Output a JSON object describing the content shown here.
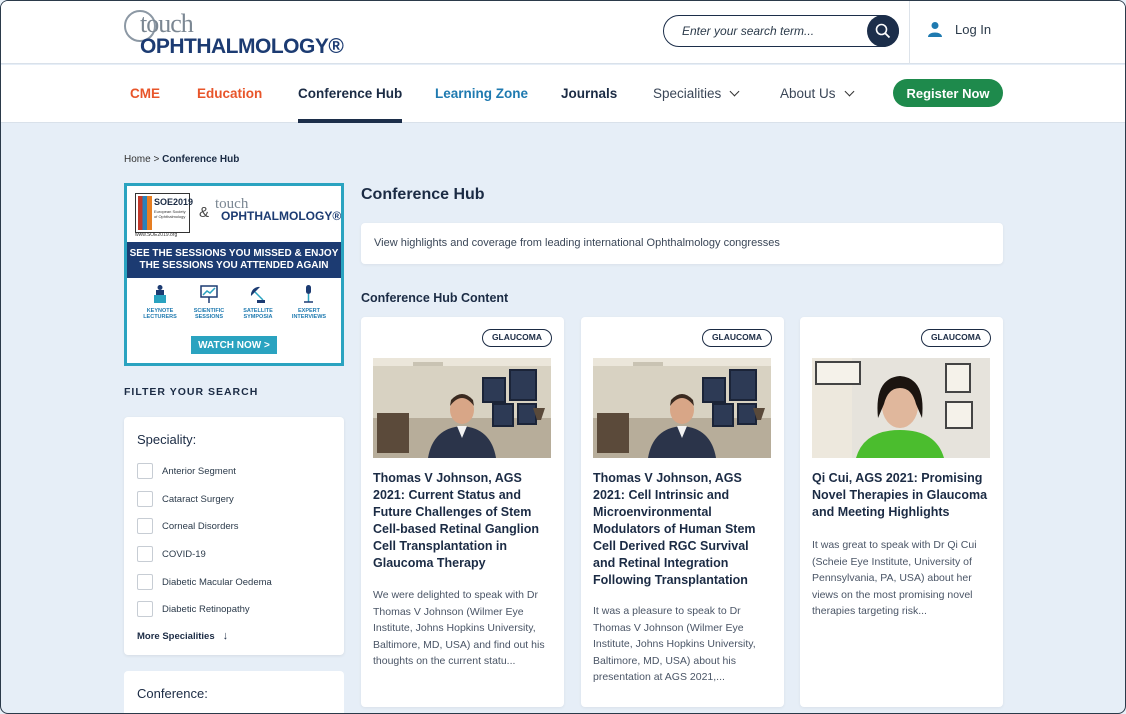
{
  "header": {
    "logo_small": "touch",
    "logo_main": "OPHTHALMOLOGY®",
    "search_placeholder": "Enter your search term...",
    "login_label": "Log In"
  },
  "nav": {
    "items": [
      {
        "label": "CME",
        "color": "#e8552a"
      },
      {
        "label": "Education",
        "color": "#e8552a"
      },
      {
        "label": "Conference Hub",
        "color": "#1b2b44",
        "active": true
      },
      {
        "label": "Learning Zone",
        "color": "#1f7ab0"
      },
      {
        "label": "Journals",
        "color": "#1b2b44"
      },
      {
        "label": "Specialities",
        "color": "#3a4657",
        "dropdown": true
      },
      {
        "label": "About Us",
        "color": "#3a4657",
        "dropdown": true
      }
    ],
    "register_label": "Register Now"
  },
  "breadcrumb": {
    "home": "Home",
    "separator": ">",
    "current": "Conference Hub"
  },
  "banner": {
    "soe_title": "SOE2019",
    "soe_subtitle": "European Society of Ophthalmology",
    "soe_url": "www.SOE2019.org",
    "amp": "&",
    "logo_small": "touch",
    "logo_main": "OPHTHALMOLOGY®",
    "headline": "SEE THE SESSIONS YOU MISSED & ENJOY THE SESSIONS YOU ATTENDED AGAIN",
    "icons": [
      {
        "label": "KEYNOTE LECTURERS",
        "icon": "podium-icon"
      },
      {
        "label": "SCIENTIFIC SESSIONS",
        "icon": "presentation-icon"
      },
      {
        "label": "SATELLITE SYMPOSIA",
        "icon": "satellite-icon"
      },
      {
        "label": "EXPERT INTERVIEWS",
        "icon": "microphone-icon"
      }
    ],
    "cta": "WATCH NOW >"
  },
  "filter": {
    "title": "FILTER YOUR SEARCH",
    "speciality_heading": "Speciality:",
    "specialities": [
      "Anterior Segment",
      "Cataract Surgery",
      "Corneal Disorders",
      "COVID-19",
      "Diabetic Macular Oedema",
      "Diabetic Retinopathy"
    ],
    "more_label": "More Specialities",
    "conference_heading": "Conference:"
  },
  "main": {
    "title": "Conference Hub",
    "intro": "View highlights and coverage from leading international Ophthalmology congresses",
    "section_title": "Conference Hub Content",
    "cards": [
      {
        "tag": "GLAUCOMA",
        "title": "Thomas V Johnson, AGS 2021: Current Status and Future Challenges of Stem Cell-based Retinal Ganglion Cell Transplantation in Glaucoma Therapy",
        "description": "We were delighted to speak with Dr Thomas V Johnson (Wilmer Eye Institute, Johns Hopkins University, Baltimore, MD, USA) and find out his thoughts on the current statu..."
      },
      {
        "tag": "GLAUCOMA",
        "title": "Thomas V Johnson, AGS 2021: Cell Intrinsic and Microenvironmental Modulators of Human Stem Cell Derived RGC Survival and Retinal Integration Following Transplantation",
        "description": "It was a pleasure to speak to Dr Thomas V Johnson (Wilmer Eye Institute, Johns Hopkins University, Baltimore, MD, USA) about his presentation at AGS 2021,..."
      },
      {
        "tag": "GLAUCOMA",
        "title": "Qi Cui, AGS 2021: Promising Novel Therapies in Glaucoma and Meeting Highlights",
        "description": "It was great to speak with Dr Qi Cui (Scheie Eye Institute, University of Pennsylvania, PA, USA) about her views on the most promising novel therapies targeting risk..."
      }
    ]
  },
  "colors": {
    "brand_navy": "#1c3b72",
    "accent_green": "#1e8a4c",
    "accent_orange": "#e8552a",
    "accent_blue": "#1f7ab0",
    "banner_teal": "#2aa3c0"
  }
}
